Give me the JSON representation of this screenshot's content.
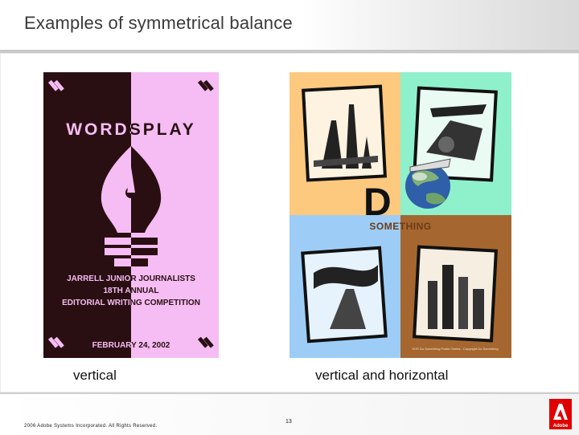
{
  "slide": {
    "title": "Examples of symmetrical balance",
    "captions": {
      "left": "vertical",
      "right": "vertical and horizontal"
    },
    "footer": {
      "copyright": "2006 Adobe Systems Incorporated. All Rights Reserved.",
      "page_number": "13",
      "logo_text": "Adobe"
    }
  },
  "poster_wordsplay": {
    "heading": "WORDSPLAY",
    "line1": "JARRELL JUNIOR JOURNALISTS",
    "line2": "18TH ANNUAL",
    "line3": "EDITORIAL WRITING COMPETITION",
    "date": "FEBRUARY 24, 2002"
  },
  "poster_do_something": {
    "title_big": "D",
    "subtitle": "SOMETHING",
    "footer_fine_print": "SOS Do Something Poster Series - Copyright Do Something"
  },
  "colors": {
    "wordsplay_dark": "#2a0f12",
    "wordsplay_pink": "#f5bdf3",
    "quad_orange": "#fcc97e",
    "quad_mint": "#8ff0cc",
    "quad_blue": "#9dcdf6",
    "quad_brown": "#a5672f",
    "adobe_red": "#e00000"
  }
}
